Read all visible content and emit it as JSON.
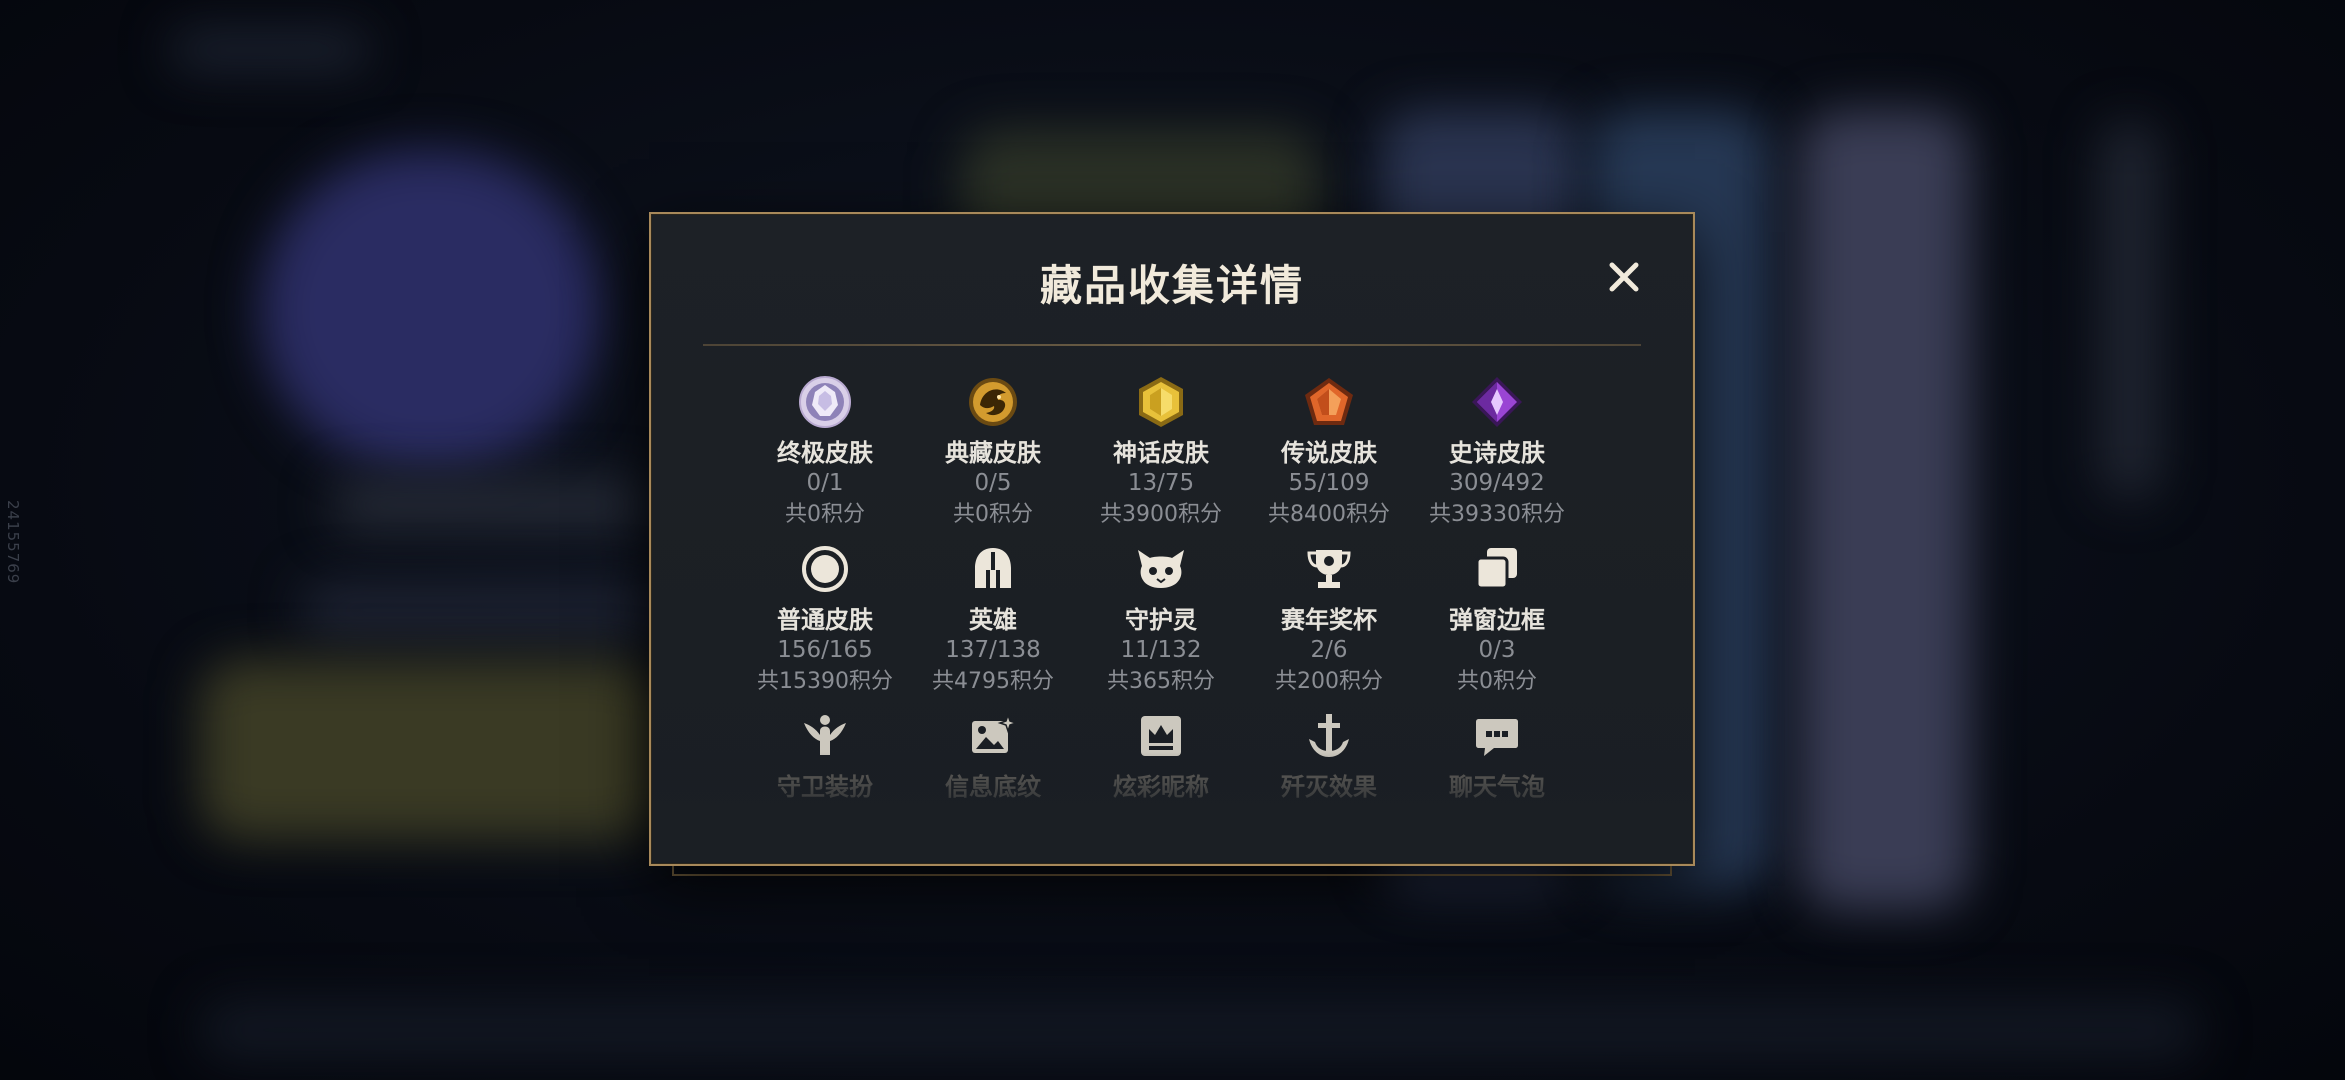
{
  "side_id": "24155769",
  "modal": {
    "title": "藏品收集详情",
    "close_label": "✕"
  },
  "rows": [
    [
      {
        "label": "终极皮肤",
        "count": "0/1",
        "points": "共0积分",
        "icon": "ultimate-gem-icon"
      },
      {
        "label": "典藏皮肤",
        "count": "0/5",
        "points": "共0积分",
        "icon": "dragon-emblem-icon"
      },
      {
        "label": "神话皮肤",
        "count": "13/75",
        "points": "共3900积分",
        "icon": "mythic-gem-icon"
      },
      {
        "label": "传说皮肤",
        "count": "55/109",
        "points": "共8400积分",
        "icon": "legendary-gem-icon"
      },
      {
        "label": "史诗皮肤",
        "count": "309/492",
        "points": "共39330积分",
        "icon": "epic-gem-icon"
      }
    ],
    [
      {
        "label": "普通皮肤",
        "count": "156/165",
        "points": "共15390积分",
        "icon": "circle-icon"
      },
      {
        "label": "英雄",
        "count": "137/138",
        "points": "共4795积分",
        "icon": "helmet-icon"
      },
      {
        "label": "守护灵",
        "count": "11/132",
        "points": "共365积分",
        "icon": "poro-icon"
      },
      {
        "label": "赛年奖杯",
        "count": "2/6",
        "points": "共200积分",
        "icon": "trophy-icon"
      },
      {
        "label": "弹窗边框",
        "count": "0/3",
        "points": "共0积分",
        "icon": "frames-icon"
      }
    ],
    [
      {
        "label": "守卫装扮",
        "icon": "ward-icon"
      },
      {
        "label": "信息底纹",
        "icon": "image-sparkle-icon"
      },
      {
        "label": "炫彩昵称",
        "icon": "crown-card-icon"
      },
      {
        "label": "歼灭效果",
        "icon": "anchor-icon"
      },
      {
        "label": "聊天气泡",
        "icon": "chat-bubble-icon"
      }
    ]
  ],
  "colors": {
    "frame_gold": "#a8895a",
    "title": "#f1eadb",
    "label": "#e6e3dc",
    "sub": "#8b8e94"
  }
}
